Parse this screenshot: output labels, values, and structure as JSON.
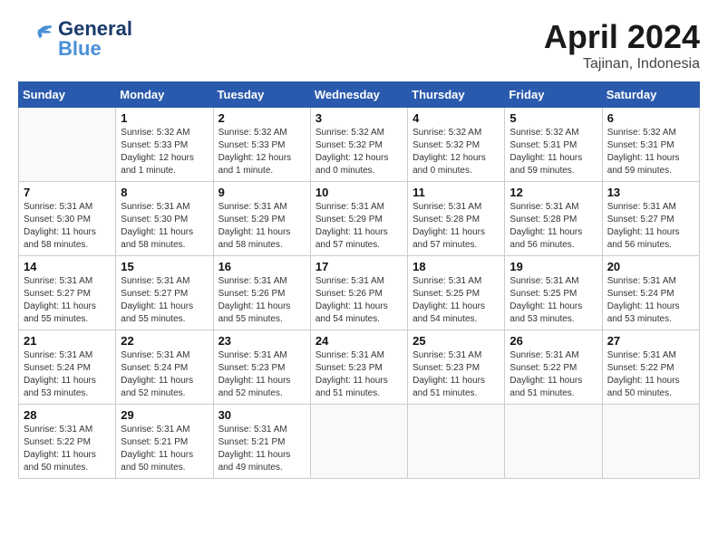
{
  "header": {
    "logo_general": "General",
    "logo_blue": "Blue",
    "month": "April 2024",
    "location": "Tajinan, Indonesia"
  },
  "weekdays": [
    "Sunday",
    "Monday",
    "Tuesday",
    "Wednesday",
    "Thursday",
    "Friday",
    "Saturday"
  ],
  "weeks": [
    [
      {
        "day": "",
        "info": ""
      },
      {
        "day": "1",
        "info": "Sunrise: 5:32 AM\nSunset: 5:33 PM\nDaylight: 12 hours\nand 1 minute."
      },
      {
        "day": "2",
        "info": "Sunrise: 5:32 AM\nSunset: 5:33 PM\nDaylight: 12 hours\nand 1 minute."
      },
      {
        "day": "3",
        "info": "Sunrise: 5:32 AM\nSunset: 5:32 PM\nDaylight: 12 hours\nand 0 minutes."
      },
      {
        "day": "4",
        "info": "Sunrise: 5:32 AM\nSunset: 5:32 PM\nDaylight: 12 hours\nand 0 minutes."
      },
      {
        "day": "5",
        "info": "Sunrise: 5:32 AM\nSunset: 5:31 PM\nDaylight: 11 hours\nand 59 minutes."
      },
      {
        "day": "6",
        "info": "Sunrise: 5:32 AM\nSunset: 5:31 PM\nDaylight: 11 hours\nand 59 minutes."
      }
    ],
    [
      {
        "day": "7",
        "info": "Sunrise: 5:31 AM\nSunset: 5:30 PM\nDaylight: 11 hours\nand 58 minutes."
      },
      {
        "day": "8",
        "info": "Sunrise: 5:31 AM\nSunset: 5:30 PM\nDaylight: 11 hours\nand 58 minutes."
      },
      {
        "day": "9",
        "info": "Sunrise: 5:31 AM\nSunset: 5:29 PM\nDaylight: 11 hours\nand 58 minutes."
      },
      {
        "day": "10",
        "info": "Sunrise: 5:31 AM\nSunset: 5:29 PM\nDaylight: 11 hours\nand 57 minutes."
      },
      {
        "day": "11",
        "info": "Sunrise: 5:31 AM\nSunset: 5:28 PM\nDaylight: 11 hours\nand 57 minutes."
      },
      {
        "day": "12",
        "info": "Sunrise: 5:31 AM\nSunset: 5:28 PM\nDaylight: 11 hours\nand 56 minutes."
      },
      {
        "day": "13",
        "info": "Sunrise: 5:31 AM\nSunset: 5:27 PM\nDaylight: 11 hours\nand 56 minutes."
      }
    ],
    [
      {
        "day": "14",
        "info": "Sunrise: 5:31 AM\nSunset: 5:27 PM\nDaylight: 11 hours\nand 55 minutes."
      },
      {
        "day": "15",
        "info": "Sunrise: 5:31 AM\nSunset: 5:27 PM\nDaylight: 11 hours\nand 55 minutes."
      },
      {
        "day": "16",
        "info": "Sunrise: 5:31 AM\nSunset: 5:26 PM\nDaylight: 11 hours\nand 55 minutes."
      },
      {
        "day": "17",
        "info": "Sunrise: 5:31 AM\nSunset: 5:26 PM\nDaylight: 11 hours\nand 54 minutes."
      },
      {
        "day": "18",
        "info": "Sunrise: 5:31 AM\nSunset: 5:25 PM\nDaylight: 11 hours\nand 54 minutes."
      },
      {
        "day": "19",
        "info": "Sunrise: 5:31 AM\nSunset: 5:25 PM\nDaylight: 11 hours\nand 53 minutes."
      },
      {
        "day": "20",
        "info": "Sunrise: 5:31 AM\nSunset: 5:24 PM\nDaylight: 11 hours\nand 53 minutes."
      }
    ],
    [
      {
        "day": "21",
        "info": "Sunrise: 5:31 AM\nSunset: 5:24 PM\nDaylight: 11 hours\nand 53 minutes."
      },
      {
        "day": "22",
        "info": "Sunrise: 5:31 AM\nSunset: 5:24 PM\nDaylight: 11 hours\nand 52 minutes."
      },
      {
        "day": "23",
        "info": "Sunrise: 5:31 AM\nSunset: 5:23 PM\nDaylight: 11 hours\nand 52 minutes."
      },
      {
        "day": "24",
        "info": "Sunrise: 5:31 AM\nSunset: 5:23 PM\nDaylight: 11 hours\nand 51 minutes."
      },
      {
        "day": "25",
        "info": "Sunrise: 5:31 AM\nSunset: 5:23 PM\nDaylight: 11 hours\nand 51 minutes."
      },
      {
        "day": "26",
        "info": "Sunrise: 5:31 AM\nSunset: 5:22 PM\nDaylight: 11 hours\nand 51 minutes."
      },
      {
        "day": "27",
        "info": "Sunrise: 5:31 AM\nSunset: 5:22 PM\nDaylight: 11 hours\nand 50 minutes."
      }
    ],
    [
      {
        "day": "28",
        "info": "Sunrise: 5:31 AM\nSunset: 5:22 PM\nDaylight: 11 hours\nand 50 minutes."
      },
      {
        "day": "29",
        "info": "Sunrise: 5:31 AM\nSunset: 5:21 PM\nDaylight: 11 hours\nand 50 minutes."
      },
      {
        "day": "30",
        "info": "Sunrise: 5:31 AM\nSunset: 5:21 PM\nDaylight: 11 hours\nand 49 minutes."
      },
      {
        "day": "",
        "info": ""
      },
      {
        "day": "",
        "info": ""
      },
      {
        "day": "",
        "info": ""
      },
      {
        "day": "",
        "info": ""
      }
    ]
  ]
}
